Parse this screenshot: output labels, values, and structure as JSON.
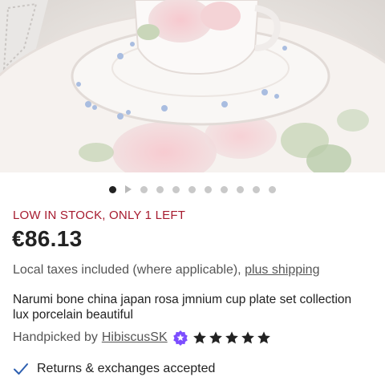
{
  "gallery": {
    "image_count": 11,
    "active_index": 0,
    "image_alt": "Rose patterned porcelain cup on saucer and plate"
  },
  "product": {
    "stock_notice": "LOW IN STOCK, ONLY 1 LEFT",
    "price": "€86.13",
    "tax_text": "Local taxes included (where applicable), ",
    "shipping_link": "plus shipping",
    "title": "Narumi bone china japan rosa jmnium cup plate set collection lux porcelain beautiful"
  },
  "seller": {
    "prefix": "Handpicked by",
    "name": "HibiscusSK",
    "badge_icon": "star-seller-badge-icon",
    "rating": 5,
    "rating_max": 5
  },
  "policy": {
    "returns_text": "Returns & exchanges accepted",
    "icon": "checkmark-icon"
  },
  "colors": {
    "stock_red": "#a61a2e",
    "badge_purple": "#7c4dff",
    "check_blue": "#2d5fb0"
  }
}
